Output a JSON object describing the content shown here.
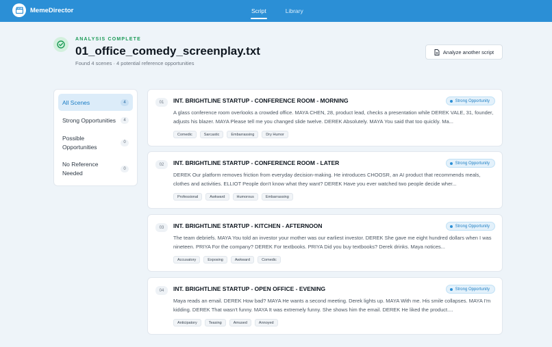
{
  "app": {
    "name": "MemeDirector",
    "logo_icon": "clapperboard-icon"
  },
  "nav": {
    "tabs": [
      {
        "label": "Script",
        "active": true
      },
      {
        "label": "Library",
        "active": false
      }
    ]
  },
  "header": {
    "status_icon": "check-circle-icon",
    "kicker": "ANALYSIS COMPLETE",
    "title": "01_office_comedy_screenplay.txt",
    "subtitle": "Found 4 scenes · 4 potential reference opportunities",
    "analyze_button": "Analyze another script"
  },
  "sidebar": {
    "items": [
      {
        "label": "All Scenes",
        "count": "4",
        "active": true
      },
      {
        "label": "Strong Opportunities",
        "count": "4",
        "active": false
      },
      {
        "label": "Possible Opportunities",
        "count": "0",
        "active": false
      },
      {
        "label": "No Reference Needed",
        "count": "0",
        "active": false
      }
    ]
  },
  "scenes": [
    {
      "number": "01",
      "heading": "INT. BRIGHTLINE STARTUP - CONFERENCE ROOM - MORNING",
      "badge": "Strong Opportunity",
      "text": "A glass conference room overlooks a crowded office. MAYA CHEN, 28, product lead, checks a presentation while DEREK VALE, 31, founder, adjusts his blazer. MAYA Please tell me you changed slide twelve. DEREK Absolutely. MAYA You said that too quickly. Ma...",
      "tags": [
        "Comedic",
        "Sarcastic",
        "Embarrassing",
        "Dry Humor"
      ]
    },
    {
      "number": "02",
      "heading": "INT. BRIGHTLINE STARTUP - CONFERENCE ROOM - LATER",
      "badge": "Strong Opportunity",
      "text": "DEREK Our platform removes friction from everyday decision-making. He introduces CHOOSR, an AI product that recommends meals, clothes and activities. ELLIOT People don't know what they want? DEREK Have you ever watched two people decide wher...",
      "tags": [
        "Professional",
        "Awkward",
        "Humorous",
        "Embarrassing"
      ]
    },
    {
      "number": "03",
      "heading": "INT. BRIGHTLINE STARTUP - KITCHEN - AFTERNOON",
      "badge": "Strong Opportunity",
      "text": "The team debriefs. MAYA You told an investor your mother was our earliest investor. DEREK She gave me eight hundred dollars when I was nineteen. PRIYA For the company? DEREK For textbooks. PRIYA Did you buy textbooks? Derek drinks. Maya notices...",
      "tags": [
        "Accusatory",
        "Exposing",
        "Awkward",
        "Comedic"
      ]
    },
    {
      "number": "04",
      "heading": "INT. BRIGHTLINE STARTUP - OPEN OFFICE - EVENING",
      "badge": "Strong Opportunity",
      "text": "Maya reads an email. DEREK How bad? MAYA He wants a second meeting. Derek lights up. MAYA With me. His smile collapses. MAYA I'm kidding. DEREK That wasn't funny. MAYA It was extremely funny. She shows him the email. DEREK He liked the product....",
      "tags": [
        "Anticipatory",
        "Teasing",
        "Amused",
        "Annoyed"
      ]
    }
  ],
  "colors": {
    "accent": "#2b8fd6",
    "success": "#1a9a55",
    "background": "#eef4f9"
  }
}
